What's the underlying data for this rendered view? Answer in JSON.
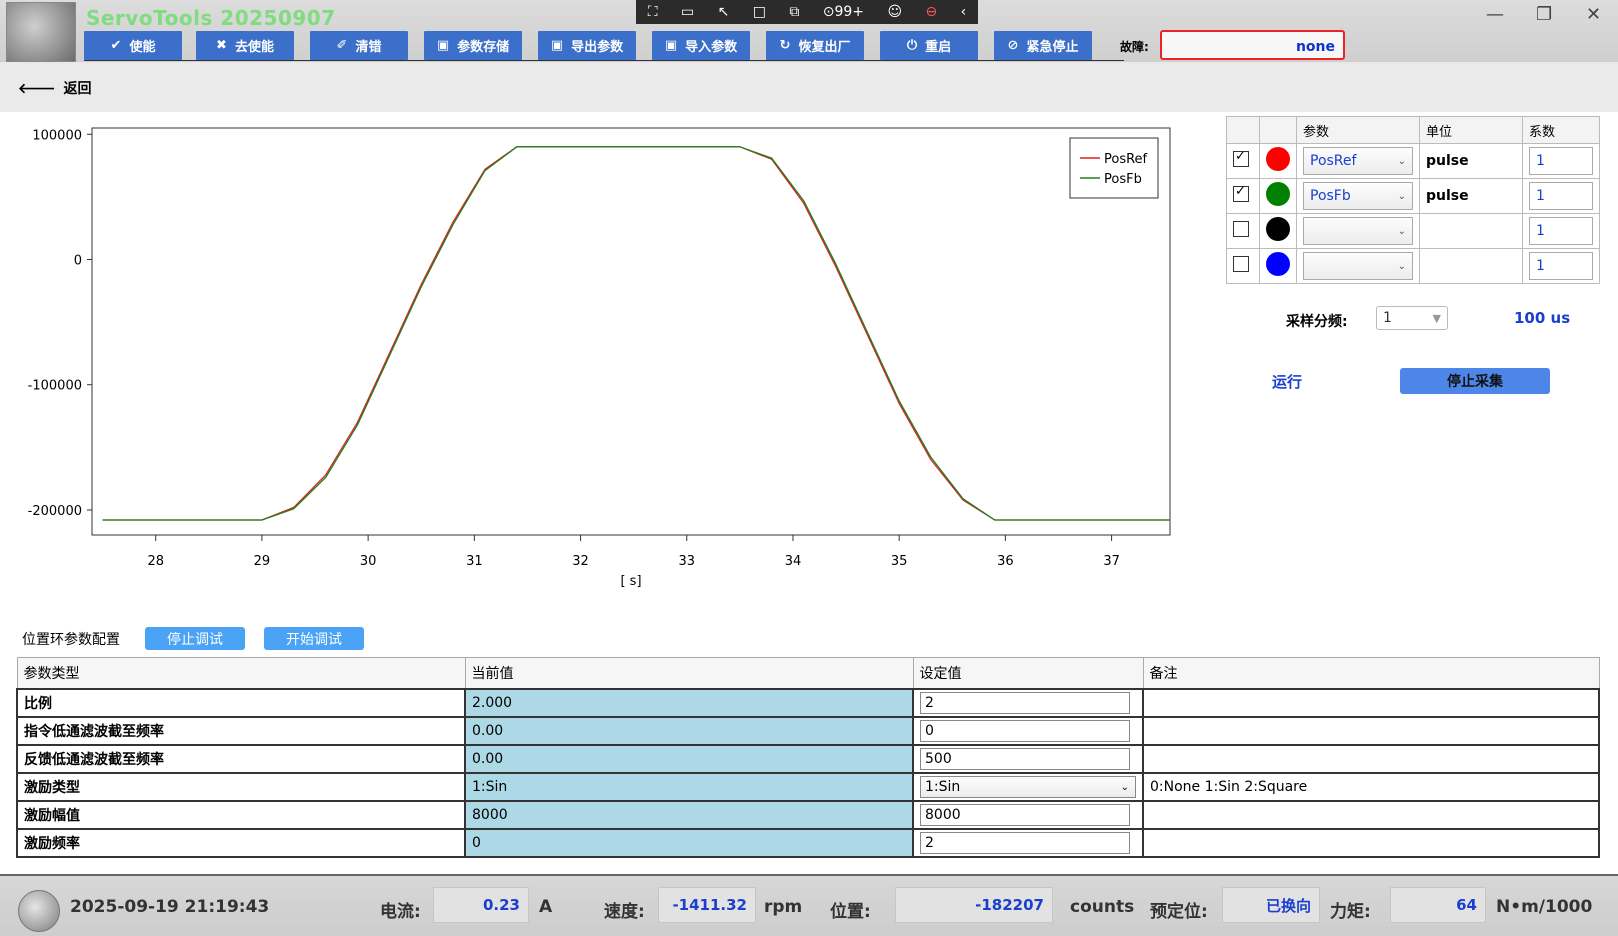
{
  "app": {
    "title": "ServoTools 20250907",
    "fault_label": "故障:",
    "fault_value": "none"
  },
  "system_tray": {
    "badge": "99+"
  },
  "toolbar": [
    {
      "label": "使能",
      "icon": "check-circle-icon"
    },
    {
      "label": "去使能",
      "icon": "x-circle-icon"
    },
    {
      "label": "清错",
      "icon": "eraser-icon"
    },
    {
      "label": "参数存储",
      "icon": "save-icon"
    },
    {
      "label": "导出参数",
      "icon": "save-icon"
    },
    {
      "label": "导入参数",
      "icon": "save-icon"
    },
    {
      "label": "恢复出厂",
      "icon": "refresh-icon"
    },
    {
      "label": "重启",
      "icon": "power-icon"
    },
    {
      "label": "紧急停止",
      "icon": "stop-circle-icon"
    }
  ],
  "back": {
    "label": "返回"
  },
  "chart_data": {
    "type": "line",
    "xlabel": "[ s]",
    "xlim": [
      27.4,
      37.55
    ],
    "ylim": [
      -220000,
      105000
    ],
    "xticks": [
      28,
      29,
      30,
      31,
      32,
      33,
      34,
      35,
      36,
      37
    ],
    "yticks": [
      100000,
      0,
      -100000,
      -200000
    ],
    "ytick_labels": [
      "100000",
      "0",
      "-100000",
      "-200000"
    ],
    "legend_position": "top-right",
    "series": [
      {
        "name": "PosRef",
        "color": "#e02020",
        "x": [
          27.5,
          29.0,
          29.3,
          29.6,
          29.9,
          30.2,
          30.5,
          30.8,
          31.1,
          31.4,
          33.5,
          33.8,
          34.1,
          34.4,
          34.7,
          35.0,
          35.3,
          35.6,
          35.9,
          37.55
        ],
        "y": [
          -208000,
          -208000,
          -198000,
          -172000,
          -130000,
          -75000,
          -20000,
          30000,
          72000,
          90000,
          90000,
          80000,
          45000,
          -5000,
          -60000,
          -115000,
          -160000,
          -192000,
          -208000,
          -208000
        ]
      },
      {
        "name": "PosFb",
        "color": "#208020",
        "x": [
          27.5,
          29.0,
          29.3,
          29.6,
          29.9,
          30.2,
          30.5,
          30.8,
          31.1,
          31.4,
          33.5,
          33.8,
          34.1,
          34.4,
          34.7,
          35.0,
          35.3,
          35.6,
          35.9,
          37.55
        ],
        "y": [
          -208000,
          -208000,
          -199000,
          -174000,
          -132000,
          -77000,
          -22000,
          28000,
          71000,
          90000,
          90000,
          81000,
          47000,
          -3000,
          -58000,
          -113000,
          -158000,
          -191000,
          -208000,
          -208000
        ]
      }
    ]
  },
  "channels": {
    "headers": [
      "参数",
      "单位",
      "系数"
    ],
    "rows": [
      {
        "checked": true,
        "color": "#ff0000",
        "param": "PosRef",
        "unit": "pulse",
        "coef": "1"
      },
      {
        "checked": true,
        "color": "#008000",
        "param": "PosFb",
        "unit": "pulse",
        "coef": "1"
      },
      {
        "checked": false,
        "color": "#000000",
        "param": "",
        "unit": "",
        "coef": "1"
      },
      {
        "checked": false,
        "color": "#0000ff",
        "param": "",
        "unit": "",
        "coef": "1"
      }
    ]
  },
  "sampling": {
    "label": "采样分频:",
    "value": "1",
    "period": "100 us"
  },
  "actions": {
    "run": "运行",
    "stop_collect": "停止采集"
  },
  "config": {
    "title": "位置环参数配置",
    "stop_debug": "停止调试",
    "start_debug": "开始调试",
    "headers": [
      "参数类型",
      "当前值",
      "设定值",
      "备注"
    ],
    "rows": [
      {
        "name": "比例",
        "current": "2.000",
        "set": "2",
        "note": ""
      },
      {
        "name": "指令低通滤波截至频率",
        "current": "0.00",
        "set": "0",
        "note": ""
      },
      {
        "name": "反馈低通滤波截至频率",
        "current": "0.00",
        "set": "500",
        "note": ""
      },
      {
        "name": "激励类型",
        "current": "1:Sin",
        "set": "1:Sin",
        "note": "0:None 1:Sin 2:Square",
        "dropdown": true
      },
      {
        "name": "激励幅值",
        "current": "8000",
        "set": "8000",
        "note": ""
      },
      {
        "name": "激励频率",
        "current": "0",
        "set": "2",
        "note": ""
      }
    ]
  },
  "status": {
    "datetime": "2025-09-19 21:19:43",
    "current_label": "电流:",
    "current_value": "0.23",
    "current_unit": "A",
    "speed_label": "速度:",
    "speed_value": "-1411.32",
    "speed_unit": "rpm",
    "position_label": "位置:",
    "position_value": "-182207",
    "position_unit": "counts",
    "prepos_label": "预定位:",
    "prepos_value": "已换向",
    "torque_label": "力矩:",
    "torque_value": "64",
    "torque_unit": "N•m/1000"
  }
}
